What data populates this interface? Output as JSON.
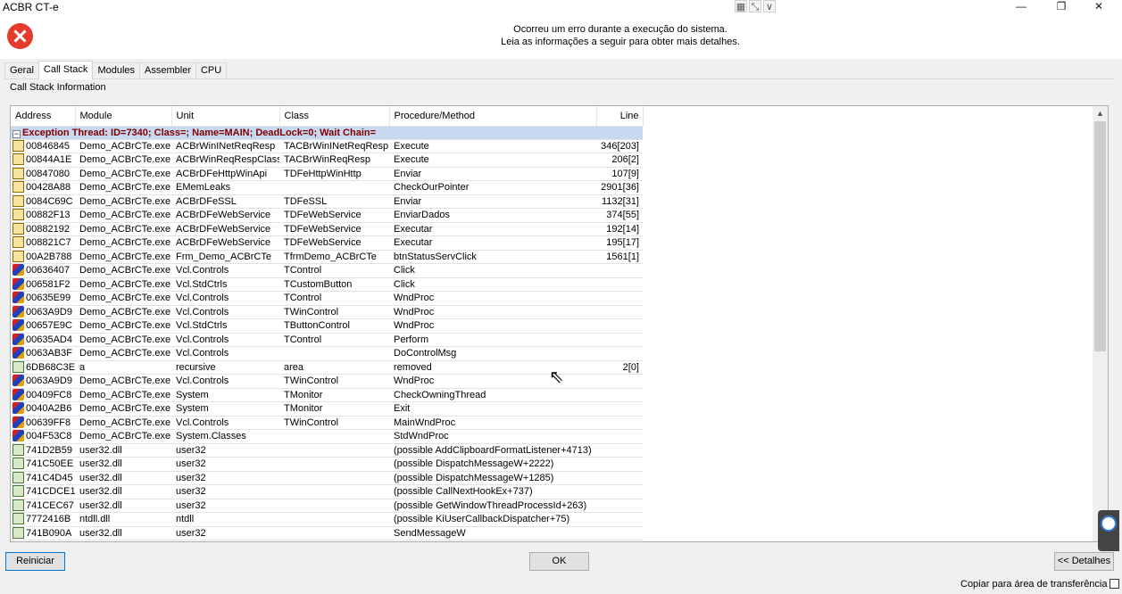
{
  "window": {
    "title": "ACBR CT-e",
    "mini_tools": [
      "▦",
      "⤡",
      "∨"
    ],
    "minimize": "—",
    "restore": "❐",
    "close": "✕"
  },
  "header": {
    "icon": "error-icon",
    "message_line1": "Ocorreu um erro durante a execução do sistema.",
    "message_line2": "Leia as informações a seguir para obter mais detalhes."
  },
  "tabs": [
    "Geral",
    "Call Stack",
    "Modules",
    "Assembler",
    "CPU"
  ],
  "active_tab": "Call Stack",
  "panel_label": "Call Stack Information",
  "grid": {
    "columns": [
      "Address",
      "Module",
      "Unit",
      "Class",
      "Procedure/Method",
      "Line"
    ],
    "thread_row": {
      "toggle": "−",
      "text": "Exception Thread: ID=7340; Class=; Name=MAIN; DeadLock=0; Wait Chain="
    },
    "rows": [
      {
        "icon": "source",
        "address": "00846845",
        "module": "Demo_ACBrCTe.exe",
        "unit": "ACBrWinINetReqResp",
        "class": "TACBrWinINetReqResp",
        "method": "Execute",
        "line": "346[203]"
      },
      {
        "icon": "source",
        "address": "00844A1E",
        "module": "Demo_ACBrCTe.exe",
        "unit": "ACBrWinReqRespClass",
        "class": "TACBrWinReqResp",
        "method": "Execute",
        "line": "206[2]"
      },
      {
        "icon": "source",
        "address": "00847080",
        "module": "Demo_ACBrCTe.exe",
        "unit": "ACBrDFeHttpWinApi",
        "class": "TDFeHttpWinHttp",
        "method": "Enviar",
        "line": "107[9]"
      },
      {
        "icon": "source",
        "address": "00428A88",
        "module": "Demo_ACBrCTe.exe",
        "unit": "EMemLeaks",
        "class": "",
        "method": "CheckOurPointer",
        "line": "2901[36]"
      },
      {
        "icon": "source",
        "address": "0084C69C",
        "module": "Demo_ACBrCTe.exe",
        "unit": "ACBrDFeSSL",
        "class": "TDFeSSL",
        "method": "Enviar",
        "line": "1132[31]"
      },
      {
        "icon": "source",
        "address": "00882F13",
        "module": "Demo_ACBrCTe.exe",
        "unit": "ACBrDFeWebService",
        "class": "TDFeWebService",
        "method": "EnviarDados",
        "line": "374[55]"
      },
      {
        "icon": "source",
        "address": "00882192",
        "module": "Demo_ACBrCTe.exe",
        "unit": "ACBrDFeWebService",
        "class": "TDFeWebService",
        "method": "Executar",
        "line": "192[14]"
      },
      {
        "icon": "source",
        "address": "008821C7",
        "module": "Demo_ACBrCTe.exe",
        "unit": "ACBrDFeWebService",
        "class": "TDFeWebService",
        "method": "Executar",
        "line": "195[17]"
      },
      {
        "icon": "source",
        "address": "00A2B788",
        "module": "Demo_ACBrCTe.exe",
        "unit": "Frm_Demo_ACBrCTe",
        "class": "TfrmDemo_ACBrCTe",
        "method": "btnStatusServClick",
        "line": "1561[1]"
      },
      {
        "icon": "component",
        "address": "00636407",
        "module": "Demo_ACBrCTe.exe",
        "unit": "Vcl.Controls",
        "class": "TControl",
        "method": "Click",
        "line": ""
      },
      {
        "icon": "component",
        "address": "006581F2",
        "module": "Demo_ACBrCTe.exe",
        "unit": "Vcl.StdCtrls",
        "class": "TCustomButton",
        "method": "Click",
        "line": ""
      },
      {
        "icon": "component",
        "address": "00635E99",
        "module": "Demo_ACBrCTe.exe",
        "unit": "Vcl.Controls",
        "class": "TControl",
        "method": "WndProc",
        "line": ""
      },
      {
        "icon": "component",
        "address": "0063A9D9",
        "module": "Demo_ACBrCTe.exe",
        "unit": "Vcl.Controls",
        "class": "TWinControl",
        "method": "WndProc",
        "line": ""
      },
      {
        "icon": "component",
        "address": "00657E9C",
        "module": "Demo_ACBrCTe.exe",
        "unit": "Vcl.StdCtrls",
        "class": "TButtonControl",
        "method": "WndProc",
        "line": ""
      },
      {
        "icon": "component",
        "address": "00635AD4",
        "module": "Demo_ACBrCTe.exe",
        "unit": "Vcl.Controls",
        "class": "TControl",
        "method": "Perform",
        "line": ""
      },
      {
        "icon": "component",
        "address": "0063AB3F",
        "module": "Demo_ACBrCTe.exe",
        "unit": "Vcl.Controls",
        "class": "",
        "method": "DoControlMsg",
        "line": ""
      },
      {
        "icon": "dll",
        "address": "6DB68C3E",
        "module": "a",
        "unit": "recursive",
        "class": "area",
        "method": "removed",
        "line": "2[0]"
      },
      {
        "icon": "component",
        "address": "0063A9D9",
        "module": "Demo_ACBrCTe.exe",
        "unit": "Vcl.Controls",
        "class": "TWinControl",
        "method": "WndProc",
        "line": ""
      },
      {
        "icon": "component",
        "address": "00409FC8",
        "module": "Demo_ACBrCTe.exe",
        "unit": "System",
        "class": "TMonitor",
        "method": "CheckOwningThread",
        "line": ""
      },
      {
        "icon": "component",
        "address": "0040A2B6",
        "module": "Demo_ACBrCTe.exe",
        "unit": "System",
        "class": "TMonitor",
        "method": "Exit",
        "line": ""
      },
      {
        "icon": "component",
        "address": "00639FF8",
        "module": "Demo_ACBrCTe.exe",
        "unit": "Vcl.Controls",
        "class": "TWinControl",
        "method": "MainWndProc",
        "line": ""
      },
      {
        "icon": "component",
        "address": "004F53C8",
        "module": "Demo_ACBrCTe.exe",
        "unit": "System.Classes",
        "class": "",
        "method": "StdWndProc",
        "line": ""
      },
      {
        "icon": "dll",
        "address": "741D2B59",
        "module": "user32.dll",
        "unit": "user32",
        "class": "",
        "method": " (possible AddClipboardFormatListener+4713)",
        "line": ""
      },
      {
        "icon": "dll",
        "address": "741C50EE",
        "module": "user32.dll",
        "unit": "user32",
        "class": "",
        "method": " (possible DispatchMessageW+2222)",
        "line": ""
      },
      {
        "icon": "dll",
        "address": "741C4D45",
        "module": "user32.dll",
        "unit": "user32",
        "class": "",
        "method": " (possible DispatchMessageW+1285)",
        "line": ""
      },
      {
        "icon": "dll",
        "address": "741CDCE1",
        "module": "user32.dll",
        "unit": "user32",
        "class": "",
        "method": " (possible CallNextHookEx+737)",
        "line": ""
      },
      {
        "icon": "dll",
        "address": "741CEC67",
        "module": "user32.dll",
        "unit": "user32",
        "class": "",
        "method": " (possible GetWindowThreadProcessId+263)",
        "line": ""
      },
      {
        "icon": "dll",
        "address": "7772416B",
        "module": "ntdll.dll",
        "unit": "ntdll",
        "class": "",
        "method": " (possible KiUserCallbackDispatcher+75)",
        "line": ""
      },
      {
        "icon": "dll",
        "address": "741B090A",
        "module": "user32.dll",
        "unit": "user32",
        "class": "",
        "method": "SendMessageW",
        "line": ""
      }
    ]
  },
  "scrollbar": {
    "up": "▲",
    "down": "▼"
  },
  "buttons": {
    "reiniciar": "Reiniciar",
    "ok": "OK",
    "detalhes": "<< Detalhes"
  },
  "copy_checkbox": {
    "label": "Copiar para área de transferência",
    "checked": false
  },
  "cursor": "mouse-pointer-icon",
  "side_widget": "remote-support-icon"
}
